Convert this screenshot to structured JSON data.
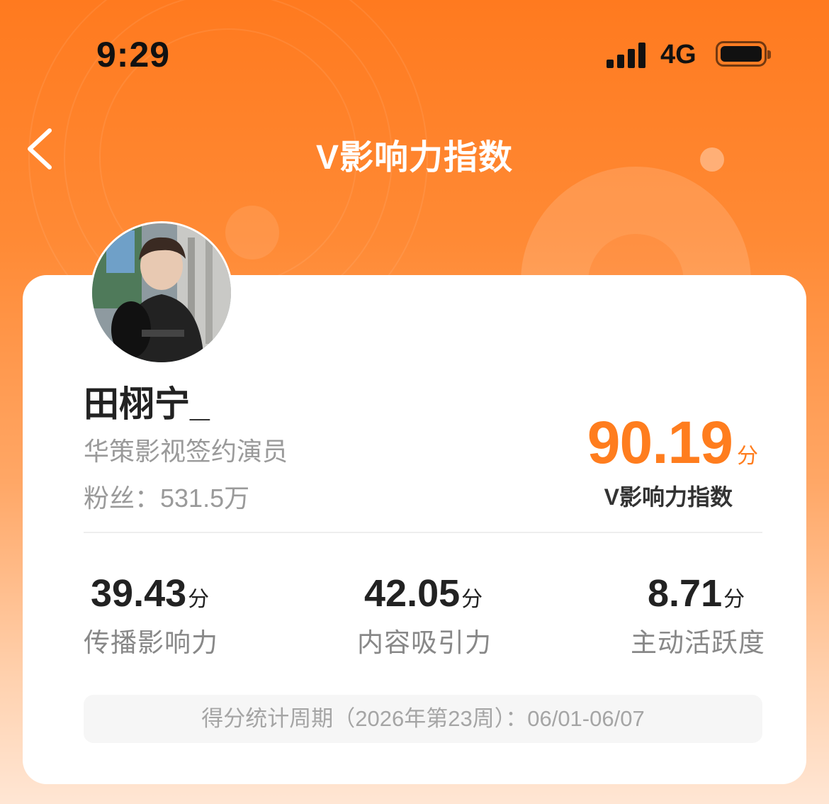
{
  "status_bar": {
    "time": "9:29",
    "network": "4G"
  },
  "nav": {
    "title": "V影响力指数",
    "back_icon": "chevron-left-icon"
  },
  "profile": {
    "name": "田栩宁_",
    "description": "华策影视签约演员",
    "fans": "粉丝：531.5万"
  },
  "score": {
    "value": "90.19",
    "unit": "分",
    "label": "V影响力指数"
  },
  "metrics": [
    {
      "value": "39.43",
      "unit": "分",
      "label": "传播影响力"
    },
    {
      "value": "42.05",
      "unit": "分",
      "label": "内容吸引力"
    },
    {
      "value": "8.71",
      "unit": "分",
      "label": "主动活跃度"
    }
  ],
  "period": "得分统计周期（2026年第23周）：06/01-06/07",
  "colors": {
    "accent": "#ff7d1e",
    "header_start": "#ff7a1f",
    "header_end": "#ffe6d4"
  }
}
